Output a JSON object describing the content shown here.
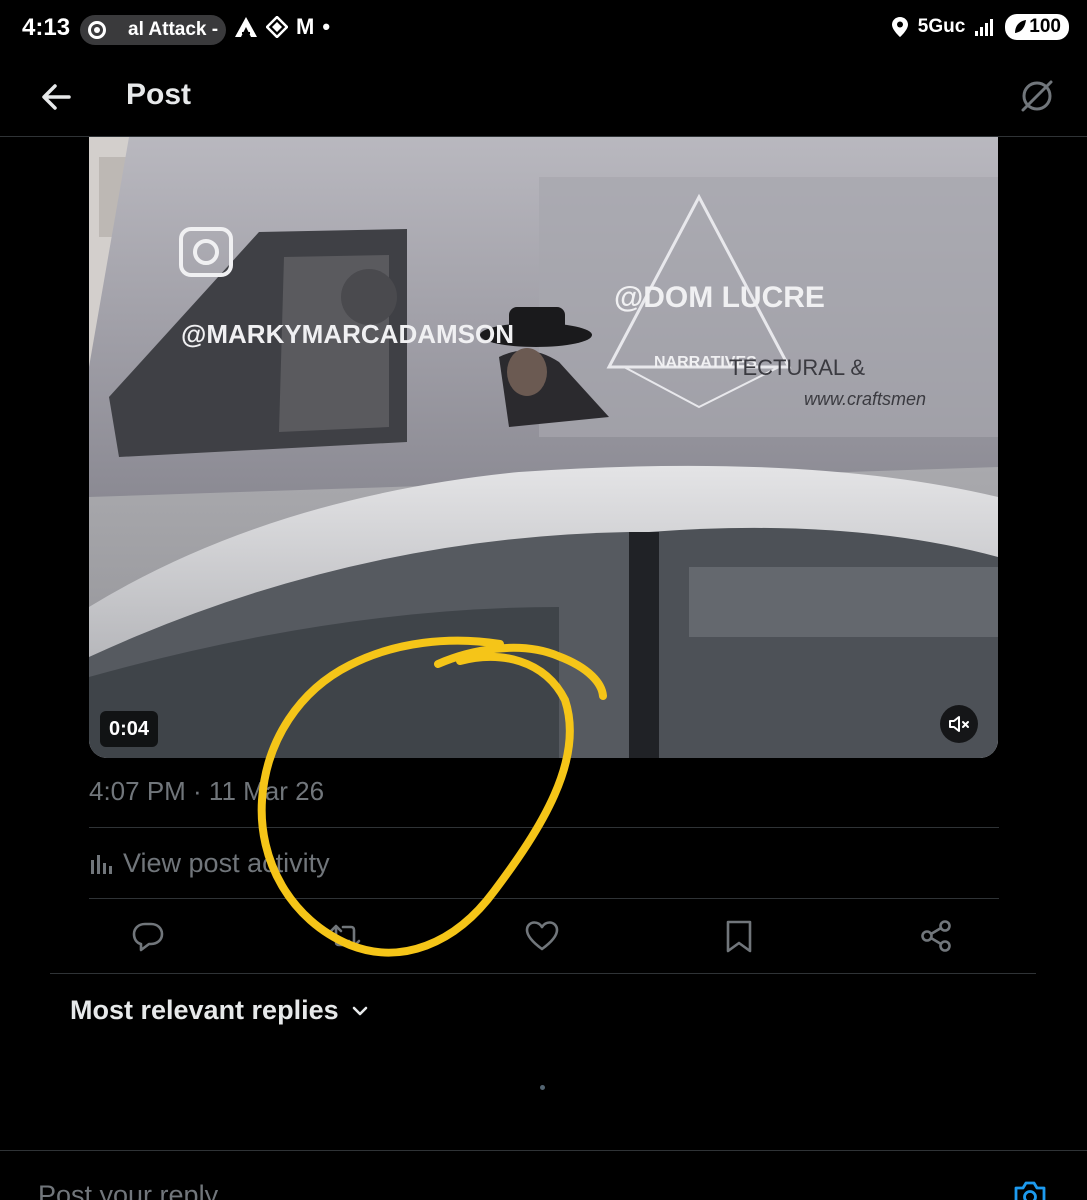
{
  "status_bar": {
    "time": "4:13",
    "notification_text": "al Attack - ",
    "notification_icons": [
      "M",
      "•"
    ],
    "network": "5Guc",
    "battery": "100"
  },
  "nav": {
    "title": "Post",
    "back_icon": "arrow-left-icon",
    "grok_icon": "grok-icon"
  },
  "media": {
    "duration": "0:04",
    "watermark_1": "@MARKYMARCADAMSON",
    "watermark_2": "@DOM LUCRE",
    "watermark_3": "NARRATIVES",
    "van_text_1": "TECTURAL &",
    "van_text_2": "www.craftsmen",
    "muted": true
  },
  "post": {
    "timestamp": "4:07 PM · 11 Mar 26",
    "activity_label": "View post activity"
  },
  "actions": [
    "reply-icon",
    "repost-icon",
    "like-icon",
    "bookmark-icon",
    "share-icon"
  ],
  "replies": {
    "sort_label": "Most relevant replies"
  },
  "composer": {
    "placeholder": "Post your reply"
  },
  "colors": {
    "background": "#000000",
    "text_primary": "#e7e9ea",
    "text_secondary": "#71767b",
    "divider": "#2f3336",
    "accent": "#1d9bf0",
    "annotation": "#f5c518"
  }
}
